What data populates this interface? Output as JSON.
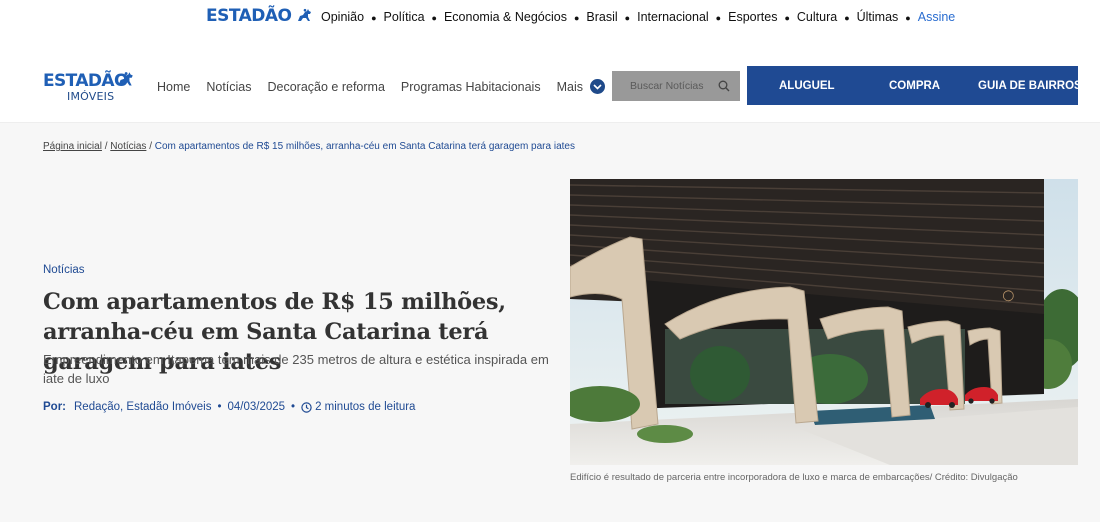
{
  "topbar": {
    "logo_text": "ESTADÃO",
    "nav": [
      "Opinião",
      "Política",
      "Economia & Negócios",
      "Brasil",
      "Internacional",
      "Esportes",
      "Cultura",
      "Últimas"
    ],
    "assine": "Assine"
  },
  "header": {
    "logo_text": "ESTADÃO",
    "logo_sub": "IMÓVEIS",
    "nav": [
      "Home",
      "Notícias",
      "Decoração e reforma",
      "Programas Habitacionais"
    ],
    "mais": "Mais",
    "search_placeholder": "Buscar Notícias",
    "actions": [
      "ALUGUEL",
      "COMPRA",
      "GUIA DE BAIRROS"
    ]
  },
  "breadcrumb": {
    "home": "Página inicial",
    "section": "Notícias",
    "current": "Com apartamentos de R$ 15 milhões, arranha-céu em Santa Catarina terá garagem para iates"
  },
  "article": {
    "category": "Notícias",
    "headline": "Com apartamentos de R$ 15 milhões, arranha-céu em Santa Catarina terá garagem para iates",
    "subtitle": "Empreendimento em Itapema tem mais de 235 metros de altura e estética inspirada em iate de luxo",
    "by_label": "Por:",
    "author": "Redação, Estadão Imóveis",
    "date": "04/03/2025",
    "read_time": "2 minutos de leitura",
    "image_caption": "Edifício é resultado de parceria entre incorporadora de luxo e marca de embarcações/ Crédito: Divulgação"
  },
  "colors": {
    "brand_blue": "#1f4a93",
    "logo_blue": "#1f5fb5",
    "link_blue": "#2a6dd0"
  }
}
